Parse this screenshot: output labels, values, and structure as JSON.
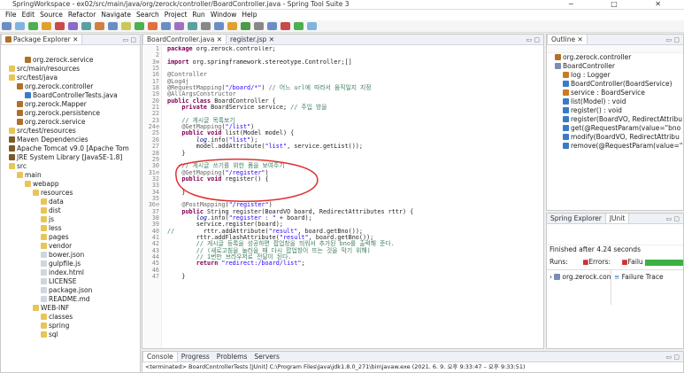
{
  "window": {
    "title": "SpringWorkspace - ex02/src/main/java/org/zerock/controller/BoardController.java - Spring Tool Suite 3",
    "controls": "─ □ ✕"
  },
  "menu": [
    "File",
    "Edit",
    "Source",
    "Refactor",
    "Navigate",
    "Search",
    "Project",
    "Run",
    "Window",
    "Help"
  ],
  "explorer": {
    "title": "Package Explorer",
    "items": [
      {
        "label": "org.zerock.service",
        "icon": "pkg",
        "indent": 3
      },
      {
        "label": "src/main/resources",
        "icon": "fold",
        "indent": 1
      },
      {
        "label": "src/test/java",
        "icon": "fold",
        "indent": 1
      },
      {
        "label": "org.zerock.controller",
        "icon": "pkg",
        "indent": 2
      },
      {
        "label": "BoardControllerTests.java",
        "icon": "java",
        "indent": 3
      },
      {
        "label": "org.zerock.Mapper",
        "icon": "pkg",
        "indent": 2
      },
      {
        "label": "org.zerock.persistence",
        "icon": "pkg",
        "indent": 2
      },
      {
        "label": "org.zerock.service",
        "icon": "pkg",
        "indent": 2
      },
      {
        "label": "src/test/resources",
        "icon": "fold",
        "indent": 1
      },
      {
        "label": "Maven Dependencies",
        "icon": "jar",
        "indent": 1
      },
      {
        "label": "Apache Tomcat v9.0 [Apache Tom",
        "icon": "jar",
        "indent": 1
      },
      {
        "label": "JRE System Library [JavaSE-1.8]",
        "icon": "jar",
        "indent": 1
      },
      {
        "label": "src",
        "icon": "fold",
        "indent": 1
      },
      {
        "label": "main",
        "icon": "fold",
        "indent": 2
      },
      {
        "label": "webapp",
        "icon": "fold",
        "indent": 3
      },
      {
        "label": "resources",
        "icon": "fold",
        "indent": 4
      },
      {
        "label": "data",
        "icon": "fold",
        "indent": 5
      },
      {
        "label": "dist",
        "icon": "fold",
        "indent": 5
      },
      {
        "label": "js",
        "icon": "fold",
        "indent": 5
      },
      {
        "label": "less",
        "icon": "fold",
        "indent": 5
      },
      {
        "label": "pages",
        "icon": "fold",
        "indent": 5
      },
      {
        "label": "vendor",
        "icon": "fold",
        "indent": 5
      },
      {
        "label": "bower.json",
        "icon": "file",
        "indent": 5
      },
      {
        "label": "gulpfile.js",
        "icon": "file",
        "indent": 5
      },
      {
        "label": "index.html",
        "icon": "file",
        "indent": 5
      },
      {
        "label": "LICENSE",
        "icon": "file",
        "indent": 5
      },
      {
        "label": "package.json",
        "icon": "file",
        "indent": 5
      },
      {
        "label": "README.md",
        "icon": "file",
        "indent": 5
      },
      {
        "label": "WEB-INF",
        "icon": "fold",
        "indent": 4
      },
      {
        "label": "classes",
        "icon": "fold",
        "indent": 5
      },
      {
        "label": "spring",
        "icon": "fold",
        "indent": 5
      },
      {
        "label": "sql",
        "icon": "fold",
        "indent": 5
      }
    ]
  },
  "editor": {
    "tabs": [
      "BoardController.java",
      "register.jsp"
    ],
    "lines": [
      {
        "n": "1",
        "h": "<span class='kw'>package</span> org.zerock.controller;"
      },
      {
        "n": "2",
        "h": ""
      },
      {
        "n": "3⊕",
        "h": "<span class='kw'>import</span> org.springframework.stereotype.Controller;[]"
      },
      {
        "n": "15",
        "h": ""
      },
      {
        "n": "16",
        "h": "<span class='an'>@Controller</span>"
      },
      {
        "n": "17",
        "h": "<span class='an'>@Log4j</span>"
      },
      {
        "n": "18",
        "h": "<span class='an'>@RequestMapping</span>(<span class='st'>\"/board/*\"</span>) <span class='cm'>// 어느 url에 따라서 움직일지 지정</span>"
      },
      {
        "n": "19",
        "h": "<span class='an'>@AllArgsConstructor</span>"
      },
      {
        "n": "20",
        "h": "<span class='kw'>public class</span> BoardController {"
      },
      {
        "n": "21",
        "h": "    <span class='kw'>private</span> BoardService service; <span class='cm'>// 주입 방을</span>"
      },
      {
        "n": "22",
        "h": ""
      },
      {
        "n": "23",
        "h": "    <span class='cm'>// 게시글 목록보기</span>"
      },
      {
        "n": "24⊖",
        "h": "    <span class='an'>@GetMapping</span>(<span class='st'>\"/list\"</span>)"
      },
      {
        "n": "25",
        "h": "    <span class='kw'>public void</span> list(Model model) {"
      },
      {
        "n": "26",
        "h": "        <span class='it'>log</span>.info(<span class='st'>\"list\"</span>);"
      },
      {
        "n": "27",
        "h": "        model.addAttribute(<span class='st'>\"list\"</span>, service.getList());"
      },
      {
        "n": "28",
        "h": "    }"
      },
      {
        "n": "29",
        "h": ""
      },
      {
        "n": "30",
        "h": "    <span class='cm'>// 게시글 쓰기를 위한 폼을 보여주기</span>"
      },
      {
        "n": "31⊖",
        "h": "    <span class='an'>@GetMapping</span>(<span class='st'>\"/register\"</span>)"
      },
      {
        "n": "32",
        "h": "    <span class='kw'>public void</span> register() {"
      },
      {
        "n": "33",
        "h": ""
      },
      {
        "n": "34",
        "h": "    }"
      },
      {
        "n": "35",
        "h": ""
      },
      {
        "n": "36⊖",
        "h": "    <span class='an'>@PostMapping</span>(<span class='st'>\"/register\"</span>)"
      },
      {
        "n": "37",
        "h": "    <span class='kw'>public</span> String register(BoardVO board, RedirectAttributes rttr) {"
      },
      {
        "n": "38",
        "h": "        <span class='it'>log</span>.info(<span class='st'>\"register : \"</span> + board);"
      },
      {
        "n": "39",
        "h": "        service.register(board);"
      },
      {
        "n": "40",
        "h": "<span class='cm'>//</span>        rttr.addAttribute(<span class='st'>\"result\"</span>, board.getBno());"
      },
      {
        "n": "41",
        "h": "        rttr.addFlashAttribute(<span class='st'>\"result\"</span>, board.getBno());"
      },
      {
        "n": "42",
        "h": "        <span class='cm'>// 게시글 등록을 성공하면 팝업창을 띄워서 추가된 bno를 출력해 준다.</span>"
      },
      {
        "n": "43",
        "h": "        <span class='cm'>// (새로고침을 눌러을 때 다시 팝업창이 뜨는 것을 막기 위해)</span>"
      },
      {
        "n": "44",
        "h": "        <span class='cm'>// 1번만 브라우저로 전달이 된다.</span>"
      },
      {
        "n": "45",
        "h": "        <span class='kw'>return</span> <span class='st'>\"redirect:/board/list\"</span>;"
      },
      {
        "n": "46",
        "h": ""
      },
      {
        "n": "47",
        "h": "    }"
      }
    ]
  },
  "outline": {
    "title": "Outline",
    "items": [
      {
        "label": "org.zerock.controller",
        "icon": "pkg",
        "indent": 1
      },
      {
        "label": "BoardController",
        "icon": "proj",
        "indent": 1
      },
      {
        "label": "log : Logger",
        "icon": "xml",
        "indent": 2
      },
      {
        "label": "BoardController(BoardService)",
        "icon": "java",
        "indent": 2
      },
      {
        "label": "service : BoardService",
        "icon": "xml",
        "indent": 2
      },
      {
        "label": "list(Model) : void",
        "icon": "java",
        "indent": 2
      },
      {
        "label": "register() : void",
        "icon": "java",
        "indent": 2
      },
      {
        "label": "register(BoardVO, RedirectAttribu",
        "icon": "java",
        "indent": 2
      },
      {
        "label": "get(@RequestParam(value=\"bno",
        "icon": "java",
        "indent": 2
      },
      {
        "label": "modify(BoardVO, RedirectAttribu",
        "icon": "java",
        "indent": 2
      },
      {
        "label": "remove(@RequestParam(value=\"",
        "icon": "java",
        "indent": 2
      }
    ]
  },
  "junit": {
    "tabs": [
      "Spring Explorer",
      "JUnit"
    ],
    "finished": "Finished after 4.24 seconds",
    "runs_label": "Runs:",
    "errors_label": "Errors:",
    "failures_label": "Failu",
    "tree_item": "org.zerock.con",
    "failure_trace": "Failure Trace"
  },
  "console": {
    "tabs": [
      "Console",
      "Progress",
      "Problems",
      "Servers"
    ],
    "status": "<terminated> BoardControllerTests [JUnit] C:\\Program Files\\Java\\jdk1.8.0_271\\bin\\javaw.exe (2021. 6. 9. 오후 9:33:47 – 오후 9:33:51)"
  }
}
